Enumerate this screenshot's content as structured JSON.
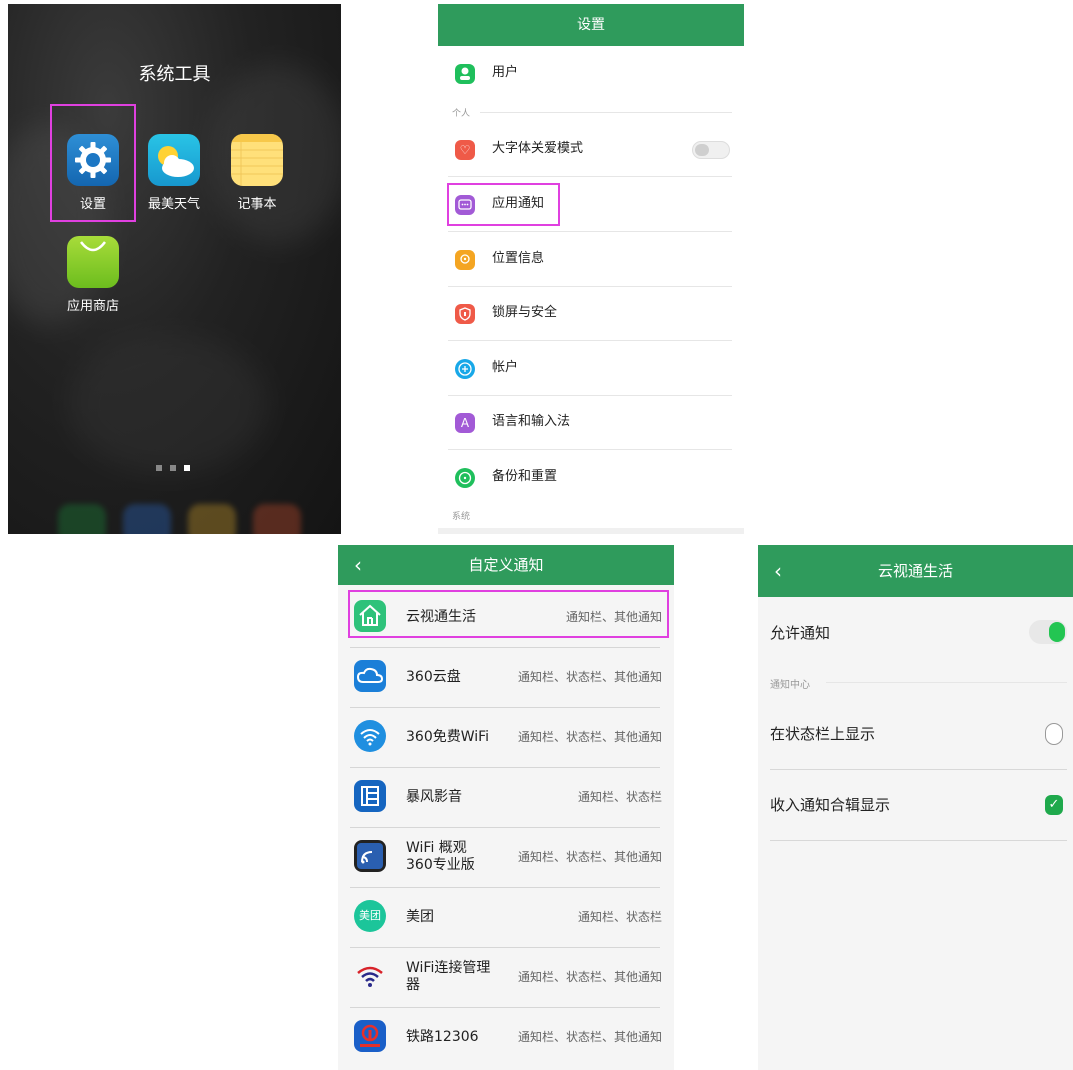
{
  "home": {
    "folder_title": "系统工具",
    "apps": [
      {
        "label": "设置"
      },
      {
        "label": "最美天气"
      },
      {
        "label": "记事本"
      },
      {
        "label": "应用商店"
      }
    ]
  },
  "settings": {
    "title": "设置",
    "user": "用户",
    "section_personal": "个人",
    "items": [
      {
        "label": "大字体关爱模式",
        "icon": "heart-icon",
        "color": "#ef5a48"
      },
      {
        "label": "应用通知",
        "icon": "message-icon",
        "color": "#a25ad6"
      },
      {
        "label": "位置信息",
        "icon": "location-icon",
        "color": "#f4a522"
      },
      {
        "label": "锁屏与安全",
        "icon": "shield-icon",
        "color": "#ef5a48"
      },
      {
        "label": "帐户",
        "icon": "plus-circle-icon",
        "color": "#18a8e8"
      },
      {
        "label": "语言和输入法",
        "icon": "language-icon",
        "color": "#a25ad6"
      },
      {
        "label": "备份和重置",
        "icon": "backup-icon",
        "color": "#1fbf5c"
      }
    ],
    "section_system": "系统"
  },
  "custom_notify": {
    "title": "自定义通知",
    "back": "‹",
    "apps": [
      {
        "name": "云视通生活",
        "desc": "通知栏、其他通知"
      },
      {
        "name": "360云盘",
        "desc": "通知栏、状态栏、其他通知"
      },
      {
        "name": "360免费WiFi",
        "desc": "通知栏、状态栏、其他通知"
      },
      {
        "name": "暴风影音",
        "desc": "通知栏、状态栏"
      },
      {
        "name": "WiFi 概观\n360专业版",
        "line1": "WiFi 概观",
        "line2": "360专业版",
        "desc": "通知栏、状态栏、其他通知"
      },
      {
        "name": "美团",
        "desc": "通知栏、状态栏"
      },
      {
        "name": "WiFi连接管理器",
        "line1": "WiFi连接管理",
        "line2": "器",
        "desc": "通知栏、状态栏、其他通知"
      },
      {
        "name": "铁路12306",
        "desc": "通知栏、状态栏、其他通知"
      }
    ],
    "meituan_icon_text": "美团"
  },
  "app_detail": {
    "title": "云视通生活",
    "back": "‹",
    "allow": "允许通知",
    "allow_on": true,
    "section": "通知中心",
    "status_bar": "在状态栏上显示",
    "status_bar_on": false,
    "collapse": "收入通知合辑显示",
    "collapse_on": true
  },
  "colors": {
    "accent": "#2f9b5c",
    "highlight": "#e040e0",
    "toggle_on": "#23c552"
  }
}
